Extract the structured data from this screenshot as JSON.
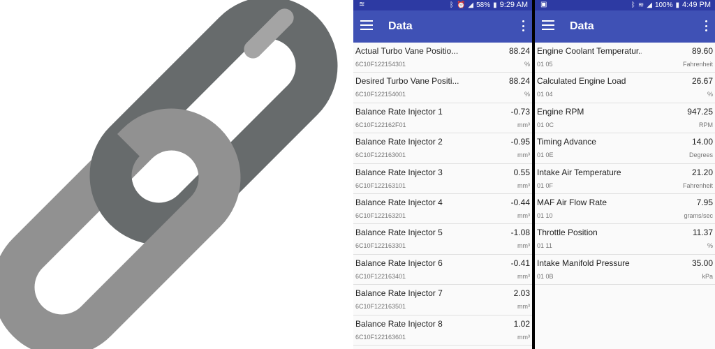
{
  "left_phone": {
    "status": {
      "battery_pct": "58%",
      "time": "9:29 AM"
    },
    "appbar": {
      "title": "Data"
    },
    "rows": [
      {
        "name": "Actual Turbo Vane Positio...",
        "value": "88.24",
        "pid": "6C10F122154301",
        "unit": "%"
      },
      {
        "name": "Desired Turbo Vane Positi...",
        "value": "88.24",
        "pid": "6C10F122154001",
        "unit": "%"
      },
      {
        "name": "Balance Rate Injector 1",
        "value": "-0.73",
        "pid": "6C10F122162F01",
        "unit": "mm³"
      },
      {
        "name": "Balance Rate Injector 2",
        "value": "-0.95",
        "pid": "6C10F122163001",
        "unit": "mm³"
      },
      {
        "name": "Balance Rate Injector 3",
        "value": "0.55",
        "pid": "6C10F122163101",
        "unit": "mm³"
      },
      {
        "name": "Balance Rate Injector 4",
        "value": "-0.44",
        "pid": "6C10F122163201",
        "unit": "mm³"
      },
      {
        "name": "Balance Rate Injector 5",
        "value": "-1.08",
        "pid": "6C10F122163301",
        "unit": "mm³"
      },
      {
        "name": "Balance Rate Injector 6",
        "value": "-0.41",
        "pid": "6C10F122163401",
        "unit": "mm³"
      },
      {
        "name": "Balance Rate Injector 7",
        "value": "2.03",
        "pid": "6C10F122163501",
        "unit": "mm³"
      },
      {
        "name": "Balance Rate Injector 8",
        "value": "1.02",
        "pid": "6C10F122163601",
        "unit": "mm³"
      }
    ]
  },
  "right_phone": {
    "status": {
      "battery_pct": "100%",
      "time": "4:49 PM"
    },
    "appbar": {
      "title": "Data"
    },
    "rows": [
      {
        "name": "Engine Coolant Temperatur...",
        "value": "89.60",
        "pid": "01 05",
        "unit": "Fahrenheit"
      },
      {
        "name": "Calculated Engine Load",
        "value": "26.67",
        "pid": "01 04",
        "unit": "%"
      },
      {
        "name": "Engine RPM",
        "value": "947.25",
        "pid": "01 0C",
        "unit": "RPM"
      },
      {
        "name": "Timing Advance",
        "value": "14.00",
        "pid": "01 0E",
        "unit": "Degrees"
      },
      {
        "name": "Intake Air Temperature",
        "value": "21.20",
        "pid": "01 0F",
        "unit": "Fahrenheit"
      },
      {
        "name": "MAF Air Flow Rate",
        "value": "7.95",
        "pid": "01 10",
        "unit": "grams/sec"
      },
      {
        "name": "Throttle Position",
        "value": "11.37",
        "pid": "01 11",
        "unit": "%"
      },
      {
        "name": "Intake Manifold Pressure",
        "value": "35.00",
        "pid": "01 0B",
        "unit": "kPa"
      }
    ]
  },
  "colors": {
    "appbar": "#3f51b5",
    "statusbar": "#2d3aa3",
    "link_dark": "#676b6c",
    "link_light": "#919191",
    "link_highlight": "#a4a4a4"
  },
  "icons": [
    "chain-link-icon",
    "menu-icon",
    "overflow-menu-icon",
    "wifi-icon",
    "bluetooth-icon",
    "alarm-icon",
    "signal-icon",
    "battery-icon",
    "image-icon"
  ]
}
